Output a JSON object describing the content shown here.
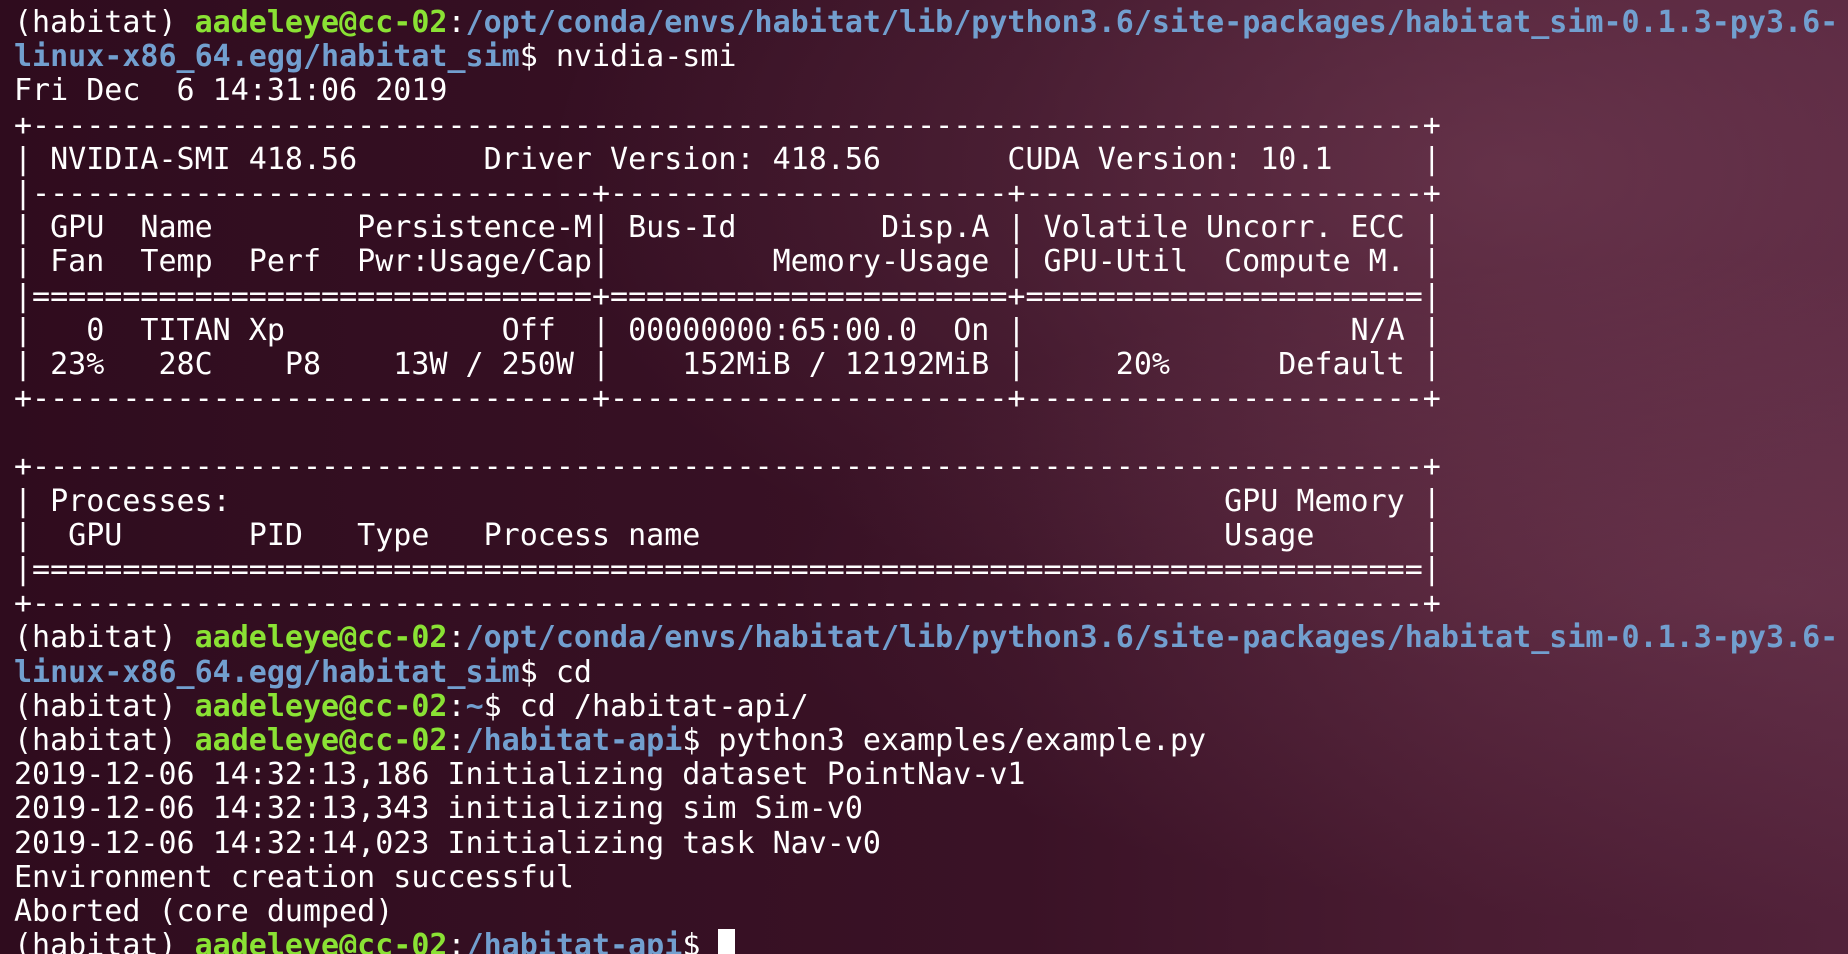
{
  "prompt": {
    "env": "(habitat)",
    "user_host": "aadeleye@cc-02",
    "colon": ":",
    "dollar": "$"
  },
  "lines": [
    {
      "kind": "prompt-wrapped",
      "path_line1": "/opt/conda/envs/habitat/lib/python3.6/site-packages/habitat_sim-0.1.3-py3.6-",
      "path_line2": "linux-x86_64.egg/habitat_sim",
      "command": " nvidia-smi"
    },
    {
      "kind": "output",
      "text": "Fri Dec  6 14:31:06 2019"
    },
    {
      "kind": "output",
      "text": "+-----------------------------------------------------------------------------+"
    },
    {
      "kind": "output",
      "text": "| NVIDIA-SMI 418.56       Driver Version: 418.56       CUDA Version: 10.1     |"
    },
    {
      "kind": "output",
      "text": "|-------------------------------+----------------------+----------------------+"
    },
    {
      "kind": "output",
      "text": "| GPU  Name        Persistence-M| Bus-Id        Disp.A | Volatile Uncorr. ECC |"
    },
    {
      "kind": "output",
      "text": "| Fan  Temp  Perf  Pwr:Usage/Cap|         Memory-Usage | GPU-Util  Compute M. |"
    },
    {
      "kind": "output",
      "text": "|===============================+======================+======================|"
    },
    {
      "kind": "output",
      "text": "|   0  TITAN Xp            Off  | 00000000:65:00.0  On |                  N/A |"
    },
    {
      "kind": "output",
      "text": "| 23%   28C    P8    13W / 250W |    152MiB / 12192MiB |     20%      Default |"
    },
    {
      "kind": "output",
      "text": "+-------------------------------+----------------------+----------------------+"
    },
    {
      "kind": "output",
      "text": ""
    },
    {
      "kind": "output",
      "text": "+-----------------------------------------------------------------------------+"
    },
    {
      "kind": "output",
      "text": "| Processes:                                                       GPU Memory |"
    },
    {
      "kind": "output",
      "text": "|  GPU       PID   Type   Process name                             Usage      |"
    },
    {
      "kind": "output",
      "text": "|=============================================================================|"
    },
    {
      "kind": "output",
      "text": "+-----------------------------------------------------------------------------+"
    },
    {
      "kind": "prompt-wrapped",
      "path_line1": "/opt/conda/envs/habitat/lib/python3.6/site-packages/habitat_sim-0.1.3-py3.6-",
      "path_line2": "linux-x86_64.egg/habitat_sim",
      "command": " cd"
    },
    {
      "kind": "prompt",
      "path": "~",
      "command": " cd /habitat-api/"
    },
    {
      "kind": "prompt",
      "path": "/habitat-api",
      "command": " python3 examples/example.py"
    },
    {
      "kind": "output",
      "text": "2019-12-06 14:32:13,186 Initializing dataset PointNav-v1"
    },
    {
      "kind": "output",
      "text": "2019-12-06 14:32:13,343 initializing sim Sim-v0"
    },
    {
      "kind": "output",
      "text": "2019-12-06 14:32:14,023 Initializing task Nav-v0"
    },
    {
      "kind": "output",
      "text": "Environment creation successful"
    },
    {
      "kind": "output",
      "text": "Aborted (core dumped)"
    },
    {
      "kind": "prompt-cursor",
      "path": "/habitat-api",
      "command": " "
    }
  ],
  "colors": {
    "user": "#8ae234",
    "path": "#729fcf",
    "text": "#ffffff",
    "background": "#2f0c1e"
  }
}
